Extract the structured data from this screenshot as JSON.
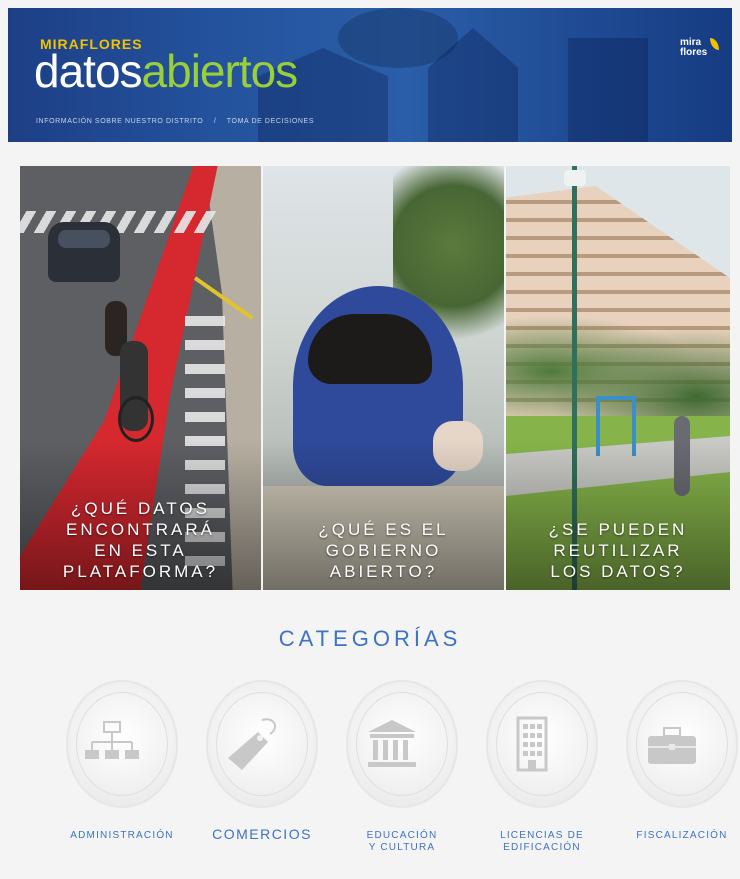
{
  "header": {
    "brand_top": "MIRAFLORES",
    "brand_word1": "datos",
    "brand_word2": "abiertos",
    "links": [
      "INFORMACIÓN SOBRE NUESTRO DISTRITO",
      "/",
      "TOMA DE DECISIONES"
    ],
    "logo_line1": "mira",
    "logo_line2": "flores"
  },
  "panels": [
    {
      "caption": "¿QUÉ DATOS\nENCONTRARÁ\nEN ESTA\nPLATAFORMA?"
    },
    {
      "caption": "¿QUÉ ES EL\nGOBIERNO\nABIERTO?"
    },
    {
      "caption": "¿SE PUEDEN\nREUTILIZAR\nLOS DATOS?"
    }
  ],
  "categories": {
    "title": "CATEGORÍAS",
    "items": [
      {
        "label": "ADMINISTRACIÓN",
        "icon": "org-chart-icon"
      },
      {
        "label": "COMERCIOS",
        "icon": "price-tag-icon"
      },
      {
        "label": "EDUCACIÓN\nY CULTURA",
        "icon": "museum-icon"
      },
      {
        "label": "LICENCIAS DE\nEDIFICACIÓN",
        "icon": "building-icon"
      },
      {
        "label": "FISCALIZACIÓN",
        "icon": "briefcase-icon"
      }
    ]
  },
  "colors": {
    "header_blue": "#24539e",
    "brand_green": "#9bcf3a",
    "brand_yellow": "#f2c200",
    "category_blue": "#3c73c4",
    "icon_gray": "#c8c8c8"
  }
}
